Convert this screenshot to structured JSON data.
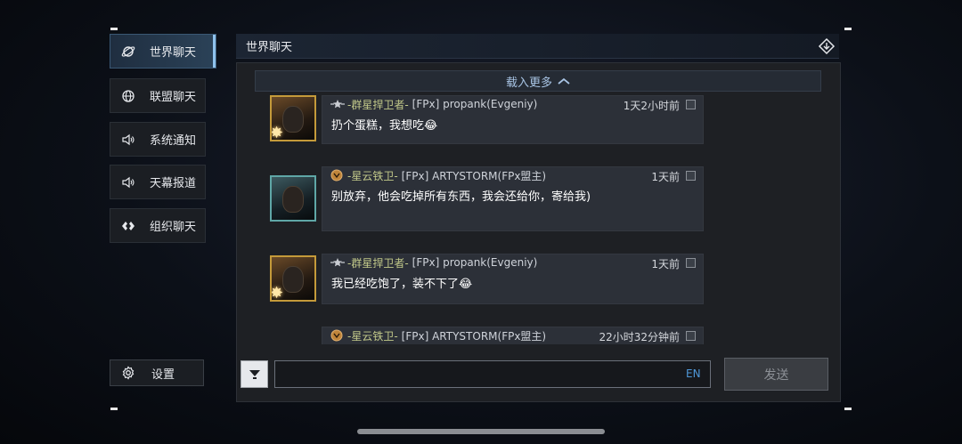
{
  "sidebar": {
    "items": [
      {
        "label": "世界聊天",
        "icon": "planet-icon",
        "active": true
      },
      {
        "label": "联盟聊天",
        "icon": "globe-icon",
        "active": false
      },
      {
        "label": "系统通知",
        "icon": "speaker-icon",
        "active": false
      },
      {
        "label": "天幕报道",
        "icon": "speaker-icon",
        "active": false
      },
      {
        "label": "组织聊天",
        "icon": "diamond-link-icon",
        "active": false
      }
    ],
    "settings_label": "设置"
  },
  "header": {
    "title": "世界聊天"
  },
  "chat": {
    "load_more_label": "载入更多",
    "messages": [
      {
        "title": "-群星捍卫者-",
        "name": "[FPx] propank(Evgeniy)",
        "time": "1天2小时前",
        "text": "扔个蛋糕，我想吃😂",
        "badge": "winged-star-icon",
        "avatar": "gold"
      },
      {
        "title": "-星云铁卫-",
        "name": "[FPx] ARTYSTORM(FPx盟主)",
        "time": "1天前",
        "text": "别放弃，他会吃掉所有东西，我会还给你，寄给我)",
        "badge": "shield-emblem-icon",
        "avatar": "teal"
      },
      {
        "title": "-群星捍卫者-",
        "name": "[FPx] propank(Evgeniy)",
        "time": "1天前",
        "text": "我已经吃饱了，装不下了😂",
        "badge": "winged-star-icon",
        "avatar": "gold"
      },
      {
        "title": "-星云铁卫-",
        "name": "[FPx] ARTYSTORM(FPx盟主)",
        "time": "22小时32分钟前",
        "text": "",
        "badge": "shield-emblem-icon",
        "avatar": "teal"
      }
    ]
  },
  "input": {
    "value": "",
    "placeholder": "",
    "lang": "EN",
    "send_label": "发送"
  },
  "colors": {
    "accent": "#8fc2ec",
    "title_gold": "#c2c98a",
    "lang_blue": "#4f97d8"
  }
}
